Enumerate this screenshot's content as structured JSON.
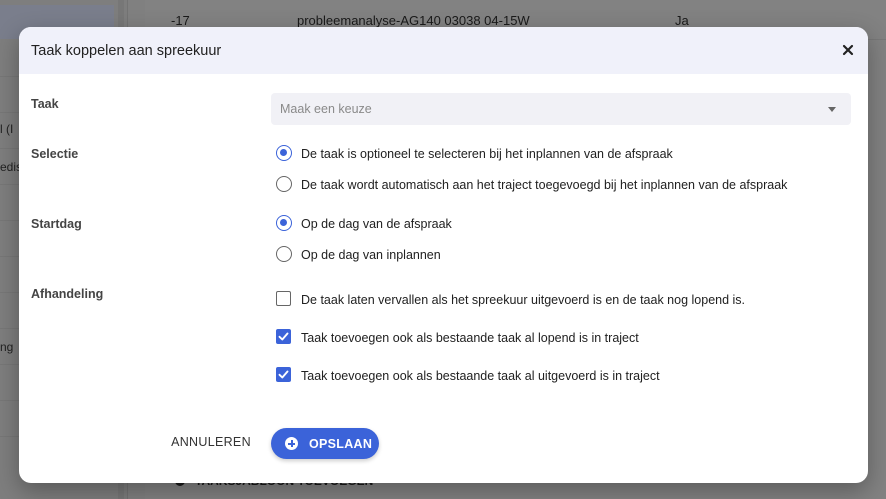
{
  "background": {
    "left_fragments": [
      "l (I",
      "edis",
      "ng"
    ],
    "row": {
      "col1": "-17",
      "col2": "probleemanalyse-AG140 03038 04-15W",
      "col3": "Ja"
    },
    "bottom_text": "TAAKSJABLOON TOEVOEGEN"
  },
  "dialog": {
    "title": "Taak koppelen aan spreekuur",
    "close_icon": "close-icon",
    "fields": {
      "taak": {
        "label": "Taak",
        "placeholder": "Maak een keuze"
      },
      "selectie": {
        "label": "Selectie",
        "options": [
          {
            "label": "De taak is optioneel te selecteren bij het inplannen van de afspraak",
            "selected": true
          },
          {
            "label": "De taak wordt automatisch aan het traject toegevoegd bij het inplannen van de afspraak",
            "selected": false
          }
        ]
      },
      "startdag": {
        "label": "Startdag",
        "options": [
          {
            "label": "Op de dag van de afspraak",
            "selected": true
          },
          {
            "label": "Op de dag van inplannen",
            "selected": false
          }
        ]
      },
      "afhandeling": {
        "label": "Afhandeling",
        "options": [
          {
            "label": "De taak laten vervallen als het spreekuur uitgevoerd is en de taak nog lopend is.",
            "checked": false
          },
          {
            "label": "Taak toevoegen ook als bestaande taak al lopend is in traject",
            "checked": true
          },
          {
            "label": "Taak toevoegen ook als bestaande taak al uitgevoerd is in traject",
            "checked": true
          }
        ]
      }
    },
    "actions": {
      "cancel_label": "ANNULEREN",
      "save_label": "OPSLAAN"
    }
  },
  "colors": {
    "accent": "#3b63d9",
    "header_bg": "#f0f1fa"
  }
}
